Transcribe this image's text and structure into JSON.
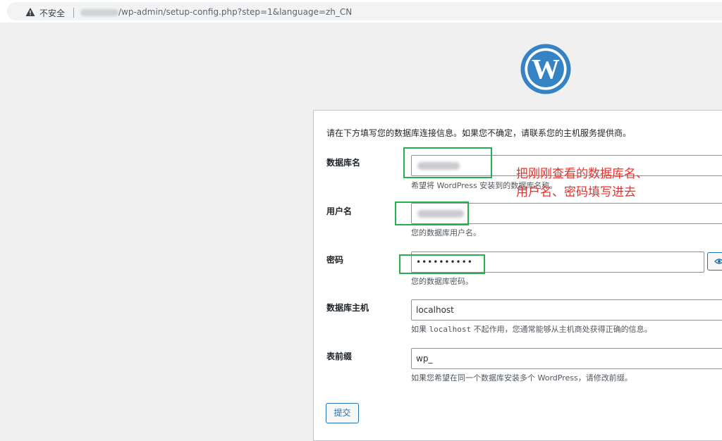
{
  "browser": {
    "security_label": "不安全",
    "url_path": "/wp-admin/setup-config.php?step=1&language=zh_CN"
  },
  "form": {
    "intro": "请在下方填写您的数据库连接信息。如果您不确定，请联系您的主机服务提供商。",
    "dbname": {
      "label": "数据库名",
      "desc": "希望将 WordPress 安装到的数据库名称。"
    },
    "username": {
      "label": "用户名",
      "desc": "您的数据库用户名。"
    },
    "password": {
      "label": "密码",
      "value": "••••••••••",
      "desc": "您的数据库密码。"
    },
    "host": {
      "label": "数据库主机",
      "value": "localhost",
      "desc_pre": "如果",
      "desc_code": "localhost",
      "desc_post": "不起作用，您通常能够从主机商处获得正确的信息。"
    },
    "prefix": {
      "label": "表前缀",
      "value": "wp_",
      "desc": "如果您希望在同一个数据库安装多个 WordPress，请修改前缀。"
    },
    "submit_label": "提交"
  },
  "annotation": {
    "line1": "把刚刚查看的数据库名、",
    "line2": "用户名、密码填写进去",
    "color": "#e8302a"
  },
  "colors": {
    "highlight": "#22b14c",
    "wp_blue": "#2271b1",
    "logo_blue": "#3582c4"
  },
  "icons": [
    "warning-icon",
    "wordpress-logo",
    "eye-icon"
  ]
}
